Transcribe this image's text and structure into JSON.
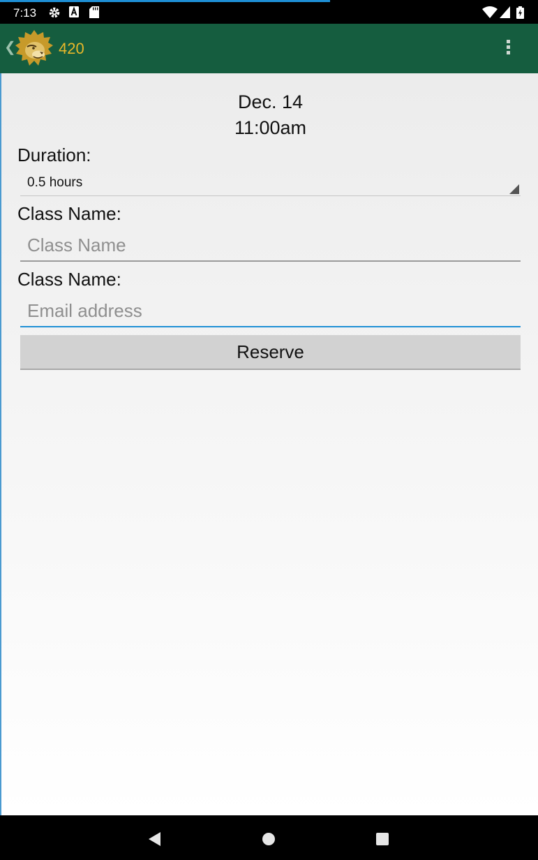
{
  "status_bar": {
    "time": "7:13",
    "left_icons": [
      "gear-icon",
      "font-a-icon",
      "sd-card-icon"
    ],
    "right_icons": [
      "wifi-icon",
      "signal-icon",
      "battery-icon"
    ]
  },
  "action_bar": {
    "title": "420",
    "logo": "lion-logo",
    "overflow": "overflow-menu-icon"
  },
  "reservation": {
    "date": "Dec. 14",
    "time": "11:00am",
    "duration_label": "Duration:",
    "duration_value": "0.5 hours",
    "class_name_label": "Class Name:",
    "class_name_placeholder": "Class Name",
    "class_name_value": "",
    "email_label": "Class Name:",
    "email_placeholder": "Email address",
    "email_value": "",
    "reserve_label": "Reserve"
  },
  "nav_bar": {
    "buttons": [
      "back-icon",
      "home-icon",
      "recents-icon"
    ]
  },
  "colors": {
    "action_bar_bg": "#155d3f",
    "title_text": "#e8b82a",
    "focus_accent": "#1e8fd5",
    "button_bg": "#d2d2d2"
  }
}
